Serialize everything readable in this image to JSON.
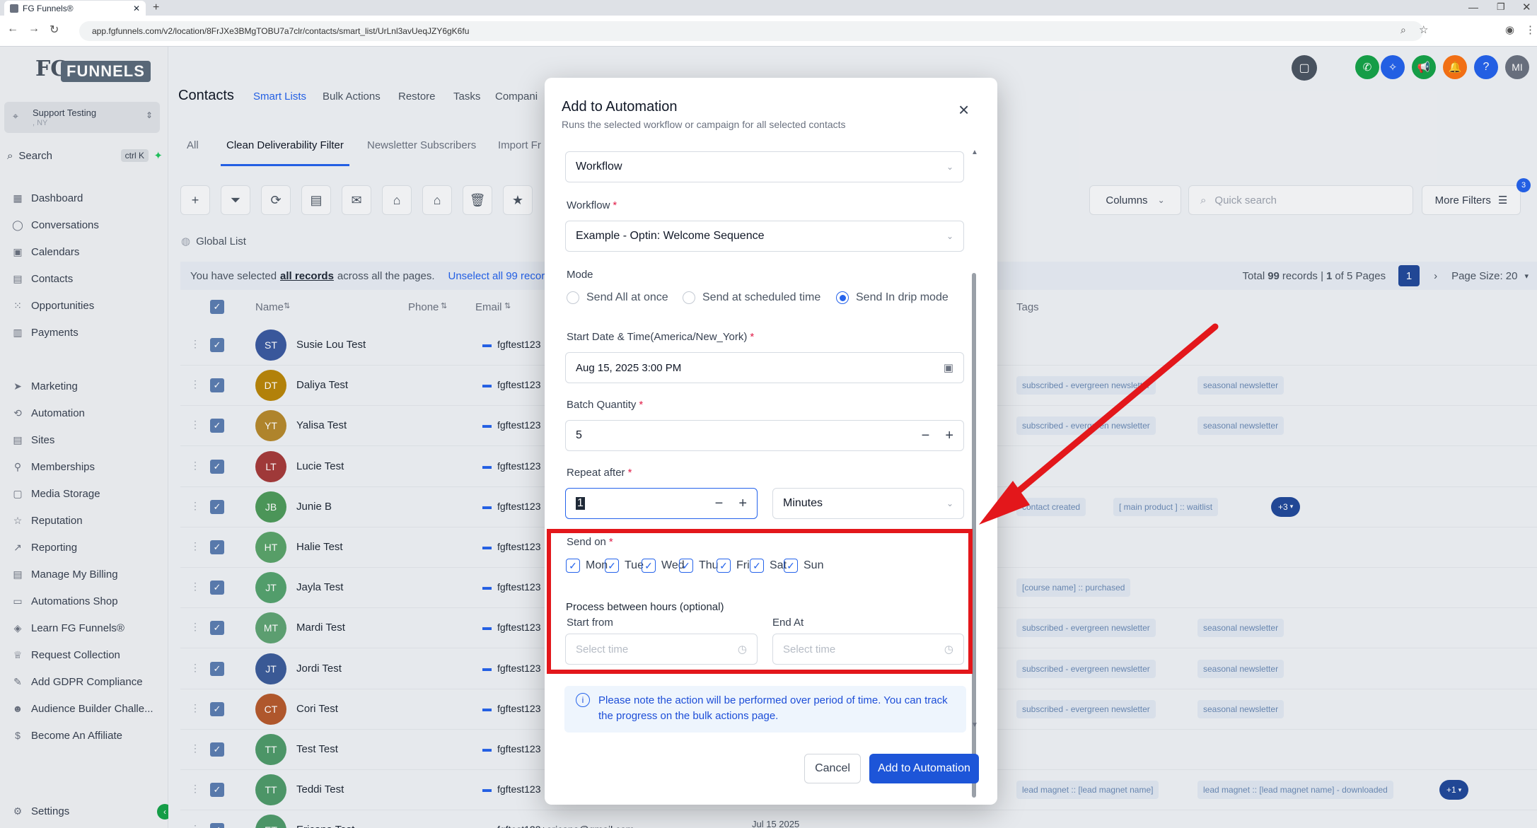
{
  "browser": {
    "tab_title": "FG Funnels®",
    "url": "app.fgfunnels.com/v2/location/8FrJXe3BMgTOBU7a7clr/contacts/smart_list/UrLnl3avUeqJZY6gK6fu"
  },
  "sidebar": {
    "logo": "FUNNELS",
    "logo_prefix": "FG",
    "account_name": "Support Testing",
    "account_sub": ", NY",
    "search_label": "Search",
    "search_shortcut": "ctrl K",
    "items": [
      {
        "label": "Dashboard",
        "icon": "grid-icon"
      },
      {
        "label": "Conversations",
        "icon": "chat-icon"
      },
      {
        "label": "Calendars",
        "icon": "calendar-icon"
      },
      {
        "label": "Contacts",
        "icon": "contacts-icon"
      },
      {
        "label": "Opportunities",
        "icon": "opportunities-icon"
      },
      {
        "label": "Payments",
        "icon": "payments-icon"
      },
      {
        "label": "Marketing",
        "icon": "send-icon"
      },
      {
        "label": "Automation",
        "icon": "automation-icon"
      },
      {
        "label": "Sites",
        "icon": "sites-icon"
      },
      {
        "label": "Memberships",
        "icon": "memberships-icon"
      },
      {
        "label": "Media Storage",
        "icon": "media-icon"
      },
      {
        "label": "Reputation",
        "icon": "star-icon"
      },
      {
        "label": "Reporting",
        "icon": "chart-icon"
      },
      {
        "label": "Manage My Billing",
        "icon": "billing-icon"
      },
      {
        "label": "Automations Shop",
        "icon": "shop-icon"
      },
      {
        "label": "Learn FG Funnels®",
        "icon": "learn-icon"
      },
      {
        "label": "Request Collection",
        "icon": "trophy-icon"
      },
      {
        "label": "Add GDPR Compliance",
        "icon": "gdpr-icon"
      },
      {
        "label": "Audience Builder Challe...",
        "icon": "audience-icon"
      },
      {
        "label": "Become An Affiliate",
        "icon": "dollar-icon"
      }
    ],
    "settings_label": "Settings"
  },
  "header": {
    "title": "Contacts",
    "tabs": [
      "Smart Lists",
      "Bulk Actions",
      "Restore",
      "Tasks",
      "Compani"
    ],
    "avatar_initials": "MI",
    "badge_count": "3"
  },
  "subtabs": [
    "All",
    "Clean Deliverability Filter",
    "Newsletter Subscribers",
    "Import Fr"
  ],
  "toolbar": {
    "columns_label": "Columns",
    "quick_search_placeholder": "Quick search",
    "more_filters_label": "More Filters"
  },
  "list": {
    "global_list": "Global List",
    "selection_prefix": "You have selected",
    "selection_link": "all records",
    "selection_suffix": "across all the pages.",
    "unselect_label": "Unselect all 99 records.",
    "total_prefix": "Total",
    "total_records": "99",
    "total_mid": "records |",
    "page_current": "1",
    "page_of": "of 5 Pages",
    "page_button": "1",
    "page_size": "Page Size: 20",
    "columns": {
      "name": "Name",
      "phone": "Phone",
      "email": "Email",
      "tags": "Tags"
    },
    "rows": [
      {
        "initials": "ST",
        "name": "Susie Lou Test",
        "email": "fgftest123",
        "color": "#3b5aa0",
        "tags": []
      },
      {
        "initials": "DT",
        "name": "Daliya Test",
        "email": "fgftest123",
        "color": "#b8860b",
        "tags": [
          "subscribed - evergreen newsletter",
          "seasonal newsletter"
        ]
      },
      {
        "initials": "YT",
        "name": "Yalisa Test",
        "email": "fgftest123",
        "color": "#b5892e",
        "tags": [
          "subscribed - evergreen newsletter",
          "seasonal newsletter"
        ]
      },
      {
        "initials": "LT",
        "name": "Lucie Test",
        "email": "fgftest123",
        "color": "#a53b3b",
        "tags": []
      },
      {
        "initials": "JB",
        "name": "Junie B",
        "email": "fgftest123",
        "color": "#4e9a5b",
        "tags": [
          "contact created",
          "[ main product ] :: waitlist"
        ],
        "more": "+3"
      },
      {
        "initials": "HT",
        "name": "Halie Test",
        "email": "fgftest123",
        "color": "#5aa46b",
        "tags": []
      },
      {
        "initials": "JT",
        "name": "Jayla Test",
        "email": "fgftest123",
        "color": "#55a36f",
        "tags": [
          "[course name] :: purchased"
        ]
      },
      {
        "initials": "MT",
        "name": "Mardi Test",
        "email": "fgftest123",
        "color": "#5fa474",
        "tags": [
          "subscribed - evergreen newsletter",
          "seasonal newsletter"
        ]
      },
      {
        "initials": "JT",
        "name": "Jordi Test",
        "email": "fgftest123",
        "color": "#3c5c9a",
        "tags": [
          "subscribed - evergreen newsletter",
          "seasonal newsletter"
        ]
      },
      {
        "initials": "CT",
        "name": "Cori Test",
        "email": "fgftest123",
        "color": "#b55a2e",
        "tags": [
          "subscribed - evergreen newsletter",
          "seasonal newsletter"
        ]
      },
      {
        "initials": "TT",
        "name": "Test Test",
        "email": "fgftest123",
        "color": "#4f9a6b",
        "tags": []
      },
      {
        "initials": "TT",
        "name": "Teddi Test",
        "email": "fgftest123",
        "color": "#4f9a6b",
        "tags": [
          "lead magnet :: [lead magnet name]",
          "lead magnet :: [lead magnet name] - downloaded"
        ],
        "more": "+1"
      },
      {
        "initials": "ET",
        "name": "Ericana Test",
        "email": "fgftest123+ericana@gmail.com",
        "color": "#4f9a6b",
        "tags": [],
        "date": "Jul 15 2025"
      }
    ]
  },
  "modal": {
    "title": "Add to Automation",
    "subtitle": "Runs the selected workflow or campaign for all selected contacts",
    "type_value": "Workflow",
    "workflow_label": "Workflow",
    "workflow_value": "Example - Optin: Welcome Sequence",
    "mode_label": "Mode",
    "modes": [
      "Send All at once",
      "Send at scheduled time",
      "Send In drip mode"
    ],
    "start_label": "Start Date & Time(America/New_York)",
    "start_value": "Aug 15, 2025 3:00 PM",
    "batch_label": "Batch Quantity",
    "batch_value": "5",
    "repeat_label": "Repeat after",
    "repeat_value": "1",
    "repeat_unit": "Minutes",
    "send_on_label": "Send on",
    "days": [
      "Mon",
      "Tue",
      "Wed",
      "Thu",
      "Fri",
      "Sat",
      "Sun"
    ],
    "hours_label": "Process between hours (optional)",
    "start_from_label": "Start from",
    "end_at_label": "End At",
    "time_placeholder": "Select time",
    "note": "Please note the action will be performed over period of time. You can track the progress on the bulk actions page.",
    "cancel_label": "Cancel",
    "submit_label": "Add to Automation"
  },
  "colors": {
    "accent": "#2563eb",
    "highlight": "#e3171b",
    "nav_blue": "#234a9a"
  }
}
